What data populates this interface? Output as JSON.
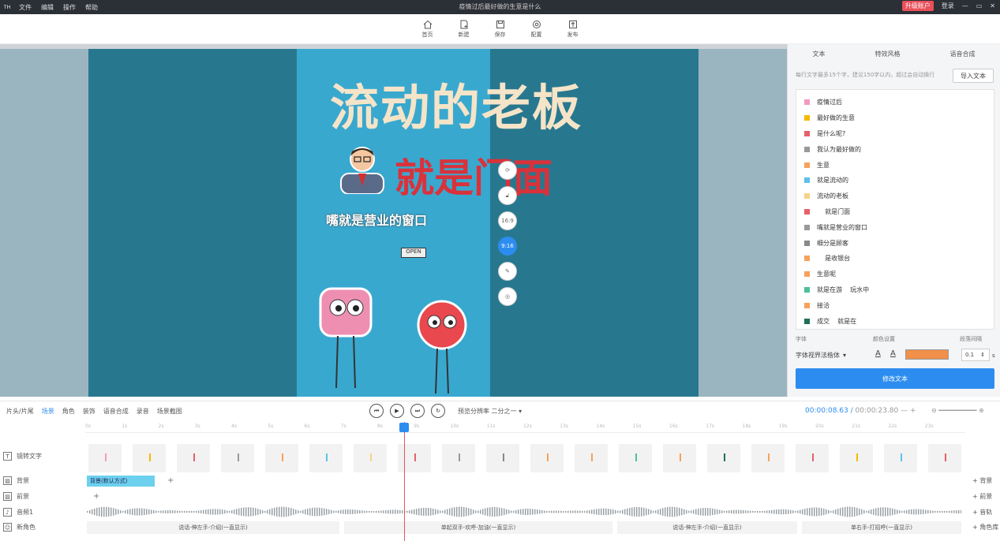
{
  "titlebar": {
    "logo": "TH",
    "menu": [
      "文件",
      "编辑",
      "操作",
      "帮助"
    ],
    "title": "疫情过后最好做的生意是什么",
    "upgrade": "升级账户",
    "login": "登录",
    "window_controls": [
      "minimize-icon",
      "restore-icon",
      "close-icon"
    ]
  },
  "toolbar": {
    "items": [
      {
        "label": "首页",
        "icon": "home-icon"
      },
      {
        "label": "新建",
        "icon": "new-file-icon"
      },
      {
        "label": "保存",
        "icon": "save-icon"
      },
      {
        "label": "配置",
        "icon": "settings-icon"
      },
      {
        "label": "发布",
        "icon": "publish-icon"
      }
    ]
  },
  "canvas": {
    "title": "流动的老板",
    "subtitle": "就是门面",
    "caption": "嘴就是营业的窗口",
    "sign": "OPEN",
    "float_controls": [
      "",
      "",
      "16:9",
      "9:16",
      "",
      ""
    ],
    "active_ratio": "9:16"
  },
  "right_panel": {
    "tabs": [
      "文本",
      "特效风格",
      "语音合成"
    ],
    "hint": "每行文字最多15个字，建议150字以内，超过会自动换行",
    "import_label": "导入文本",
    "lines": [
      {
        "text": "疫情过后",
        "color": "#f39ac0"
      },
      {
        "text": "最好做的生意",
        "color": "#f5b900"
      },
      {
        "text": "是什么呢?",
        "color": "#e5616a"
      },
      {
        "text": "我认为最好做的",
        "color": "#999999"
      },
      {
        "text": "生意",
        "color": "#f6a25c"
      },
      {
        "text": "就是流动的",
        "color": "#5ec1e9"
      },
      {
        "text": "流动的老板",
        "color": "#f7d28a"
      },
      {
        "text": "    就是门面",
        "color": "#e5616a"
      },
      {
        "text": "嘴就是营业的窗口",
        "color": "#999999"
      },
      {
        "text": "细分是顾客",
        "color": "#888888"
      },
      {
        "text": "    是收银台",
        "color": "#f6a25c"
      },
      {
        "text": "生意呢",
        "color": "#f6a25c"
      },
      {
        "text": "就是在游    玩水中",
        "color": "#4dbf9a"
      },
      {
        "text": "接洽",
        "color": "#f6a25c"
      },
      {
        "text": "成交    就是在",
        "color": "#1f6e5a"
      }
    ],
    "settings": {
      "font_label": "字体",
      "color_label": "颜色设置",
      "spacing_label": "段落间隔",
      "font_value": "字体视界法楷体",
      "color_value": "#f0904a",
      "spacing_value": "0.1",
      "spacing_unit": "s"
    },
    "apply_label": "修改文本"
  },
  "playback": {
    "left_tools": [
      "片头/片尾",
      "场景",
      "角色",
      "装饰",
      "语音合成",
      "录音",
      "场景截图"
    ],
    "active_tool": "场景",
    "ratio_label": "预览分辨率",
    "ratio_value": "二分之一",
    "current_time": "00:00:08.63",
    "total_time": "00:00:23.80"
  },
  "timeline": {
    "ruler_ticks": [
      "0s",
      "1s",
      "2s",
      "3s",
      "4s",
      "5s",
      "6s",
      "7s",
      "8s",
      "9s",
      "10s",
      "11s",
      "12s",
      "13s",
      "14s",
      "15s",
      "16s",
      "17s",
      "18s",
      "19s",
      "20s",
      "21s",
      "22s",
      "23s"
    ],
    "tracks": [
      {
        "label": "镜转文字",
        "icon": "text-track-icon"
      },
      {
        "label": "背景",
        "icon": "background-icon"
      },
      {
        "label": "前景",
        "icon": "foreground-icon"
      },
      {
        "label": "音频1",
        "icon": "audio-icon"
      },
      {
        "label": "新角色",
        "icon": "character-icon"
      }
    ],
    "bg_clip": "背景(默认方式)",
    "role_clips": [
      "说话-伸左手-介绍(一直显示)",
      "单起双手-欢呼-加油(一直显示)",
      "说话-伸左手-介绍(一直显示)",
      "单右手-打招呼(一直显示)"
    ],
    "right_add": [
      "背景",
      "前景",
      "音轨",
      "角色库"
    ],
    "clip_colors": [
      "#f39ac0",
      "#f5b900",
      "#e5616a",
      "#999999",
      "#f6a25c",
      "#5ec1e9",
      "#f7d28a",
      "#e5616a",
      "#999999",
      "#888888",
      "#f6a25c",
      "#f6a25c",
      "#4dbf9a",
      "#f6a25c",
      "#1f6e5a",
      "#f6a25c",
      "#e5616a",
      "#f5b900",
      "#5ec1e9",
      "#e5616a"
    ]
  }
}
